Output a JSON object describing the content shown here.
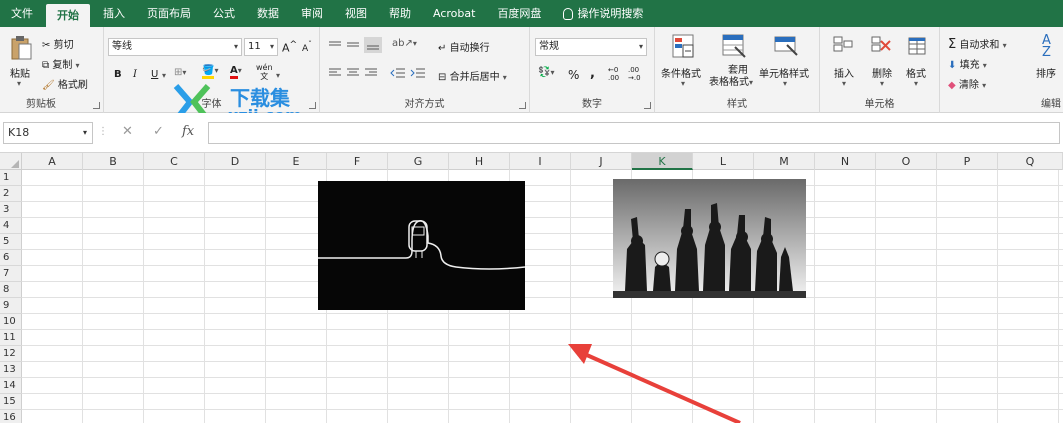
{
  "tabs": [
    {
      "label": "文件",
      "active": false
    },
    {
      "label": "开始",
      "active": true
    },
    {
      "label": "插入",
      "active": false
    },
    {
      "label": "页面布局",
      "active": false
    },
    {
      "label": "公式",
      "active": false
    },
    {
      "label": "数据",
      "active": false
    },
    {
      "label": "审阅",
      "active": false
    },
    {
      "label": "视图",
      "active": false
    },
    {
      "label": "帮助",
      "active": false
    },
    {
      "label": "Acrobat",
      "active": false
    },
    {
      "label": "百度网盘",
      "active": false
    }
  ],
  "search_label": "操作说明搜索",
  "ribbon": {
    "clipboard": {
      "label": "剪贴板",
      "paste": "粘贴",
      "cut": "剪切",
      "copy": "复制",
      "format_painter": "格式刷"
    },
    "font": {
      "label": "字体",
      "font_name": "等线",
      "font_size": "11",
      "bold": "B",
      "italic": "I",
      "underline": "U",
      "grow": "A",
      "shrink": "A",
      "phonetic": "wén",
      "phonetic_char": "文"
    },
    "alignment": {
      "label": "对齐方式",
      "wrap": "自动换行",
      "merge": "合并后居中"
    },
    "number": {
      "label": "数字",
      "format": "常规",
      "percent": "%",
      "comma": ","
    },
    "styles": {
      "label": "样式",
      "conditional": "条件格式",
      "table_line1": "套用",
      "table_line2": "表格格式",
      "cell_styles": "单元格样式"
    },
    "cells": {
      "label": "单元格",
      "insert": "插入",
      "delete": "删除",
      "format": "格式"
    },
    "editing": {
      "label": "编辑",
      "autosum": "自动求和",
      "fill": "填充",
      "clear": "清除",
      "sort": "排序"
    }
  },
  "formula_bar": {
    "name_box": "K18",
    "fx": "fx",
    "cancel": "✕",
    "enter": "✓"
  },
  "columns": [
    "A",
    "B",
    "C",
    "D",
    "E",
    "F",
    "G",
    "H",
    "I",
    "J",
    "K",
    "L",
    "M",
    "N",
    "O",
    "P",
    "Q"
  ],
  "selected_column": "K",
  "rows": [
    "1",
    "2",
    "3",
    "4",
    "5",
    "6",
    "7",
    "8",
    "9",
    "10",
    "11",
    "12",
    "13",
    "14",
    "15",
    "16"
  ],
  "watermark": {
    "brand": "下载集",
    "site": "xzji.com"
  },
  "colors": {
    "accent": "#217346",
    "arrow": "#e8403a"
  },
  "images": [
    {
      "name": "black-line-drawing",
      "description_icon": "robot-line-art"
    },
    {
      "name": "grayscale-group-photo",
      "description_icon": "raised-fists-photo"
    }
  ]
}
